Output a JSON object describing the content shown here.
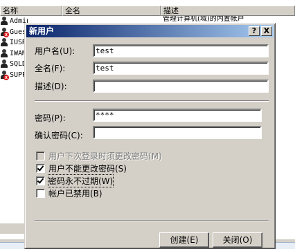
{
  "background": {
    "columns": [
      "名称",
      "全名",
      "描述"
    ],
    "rows": [
      {
        "name": "Administr",
        "disabled": false
      },
      {
        "name": "Guest",
        "disabled": true
      },
      {
        "name": "IUSR",
        "disabled": false
      },
      {
        "name": "IWAM",
        "disabled": false
      },
      {
        "name": "SQLD",
        "disabled": false
      },
      {
        "name": "SUPP",
        "disabled": true
      }
    ],
    "first_description": "管理计算机(域)的内置帐户"
  },
  "dialog": {
    "title": "新用户",
    "help_button": "?",
    "close_button": "X",
    "username_label": "用户名(U):",
    "username_value": "test",
    "fullname_label": "全名(F):",
    "fullname_value": "test",
    "description_label": "描述(D):",
    "description_value": "",
    "password_label": "密码(P):",
    "password_value": "****",
    "confirm_label": "确认密码(C):",
    "confirm_value": "",
    "checkboxes": [
      {
        "label": "用户下次登录时须更改密码(M)",
        "checked": false,
        "enabled": false
      },
      {
        "label": "用户不能更改密码(S)",
        "checked": true,
        "enabled": true
      },
      {
        "label": "密码永不过期(W)",
        "checked": true,
        "enabled": true,
        "focused": true
      },
      {
        "label": "帐户已禁用(B)",
        "checked": false,
        "enabled": true
      }
    ],
    "create_button": "创建(E)",
    "close_label": "关闭(O)"
  }
}
